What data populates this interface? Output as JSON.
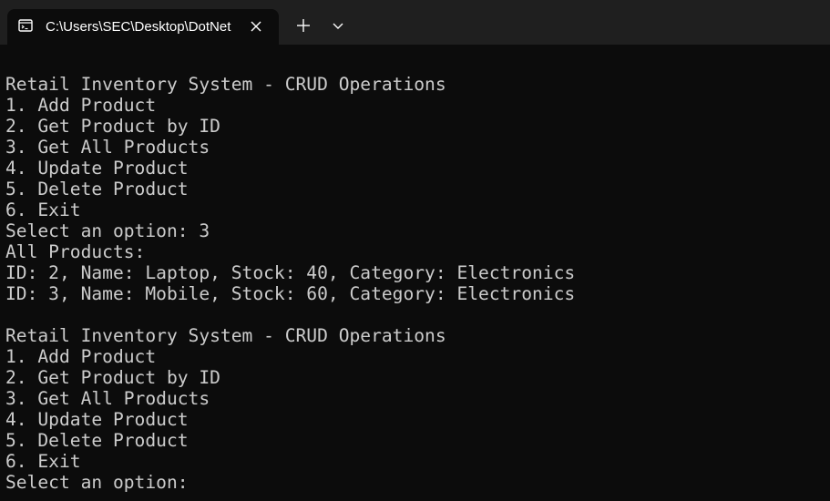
{
  "tab": {
    "title": "C:\\Users\\SEC\\Desktop\\DotNet",
    "icon": "terminal-icon"
  },
  "colors": {
    "background": "#0c0c0c",
    "titlebar": "#1f1f1f",
    "foreground": "#cccccc"
  },
  "console": {
    "lines": [
      "Retail Inventory System - CRUD Operations",
      "1. Add Product",
      "2. Get Product by ID",
      "3. Get All Products",
      "4. Update Product",
      "5. Delete Product",
      "6. Exit",
      "Select an option: 3",
      "All Products:",
      "ID: 2, Name: Laptop, Stock: 40, Category: Electronics",
      "ID: 3, Name: Mobile, Stock: 60, Category: Electronics",
      "",
      "Retail Inventory System - CRUD Operations",
      "1. Add Product",
      "2. Get Product by ID",
      "3. Get All Products",
      "4. Update Product",
      "5. Delete Product",
      "6. Exit",
      "Select an option:"
    ]
  }
}
